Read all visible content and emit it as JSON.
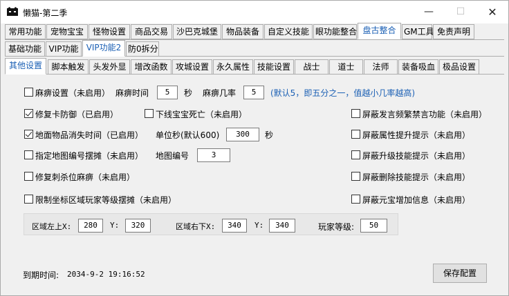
{
  "window": {
    "title": "懒猫-第二季",
    "minimize": "—",
    "maximize": "☐",
    "close": "✕"
  },
  "tabs_row1": [
    "常用功能",
    "宠物宝宝",
    "怪物设置",
    "商品交易",
    "沙巴克城堡",
    "物品装备",
    "自定义技能",
    "眼功能整合",
    "盘古整合",
    "GM工具",
    "免责声明"
  ],
  "tabs_row1_active": "盘古整合",
  "tabs_row2": [
    "基础功能",
    "VIP功能",
    "VIP功能2",
    "防0拆分"
  ],
  "tabs_row2_active": "VIP功能2",
  "tabs_row3": [
    "其他设置",
    "脚本触发",
    "头发外显",
    "增改函数",
    "攻城设置",
    "永久属性",
    "技能设置",
    "战士",
    "道士",
    "法师",
    "装备吸血",
    "极品设置"
  ],
  "tabs_row3_active": "其他设置",
  "settings": {
    "paralysis": {
      "label": "麻痹设置（未启用）",
      "checked": false
    },
    "paralysis_time_label": "麻痹时间",
    "paralysis_time_value": "5",
    "seconds_unit": "秒",
    "paralysis_rate_label": "麻痹几率",
    "paralysis_rate_value": "5",
    "paralysis_hint": "(默认5，即五分之一，值越小几率越高)",
    "fix_card_defense": {
      "label": "修复卡防御（已启用）",
      "checked": true
    },
    "offline_pet_death": {
      "label": "下线宝宝死亡（未启用）",
      "checked": false
    },
    "ground_item_disappear": {
      "label": "地面物品消失时间（已启用）",
      "checked": true
    },
    "unit_seconds_label": "单位秒(默认600)",
    "unit_seconds_value": "300",
    "seconds_unit2": "秒",
    "map_stall": {
      "label": "指定地图编号摆摊（未启用）",
      "checked": false
    },
    "map_number_label": "地图编号",
    "map_number_value": "3",
    "fix_assassin_paralysis": {
      "label": "修复刺杀位麻痹（未启用）",
      "checked": false
    },
    "limit_coord_stall": {
      "label": "限制坐标区域玩家等级摆摊（未启用）",
      "checked": false
    },
    "region_top_left_label": "区域左上X:",
    "region_top_left_x": "280",
    "y_label": "Y:",
    "region_top_left_y": "320",
    "region_bottom_right_label": "区域右下X:",
    "region_bottom_right_x": "340",
    "y_label2": "Y:",
    "region_bottom_right_y": "340",
    "player_level_label": "玩家等级:",
    "player_level_value": "50",
    "block_frequent_speech": {
      "label": "屏蔽发言频繁禁言功能（未启用）",
      "checked": false
    },
    "block_attr_upgrade": {
      "label": "屏蔽属性提升提示（未启用）",
      "checked": false
    },
    "block_skill_upgrade": {
      "label": "屏蔽升级技能提示（未启用）",
      "checked": false
    },
    "block_skill_delete": {
      "label": "屏蔽删除技能提示（未启用）",
      "checked": false
    },
    "block_yuanbao_add": {
      "label": "屏蔽元宝增加信息（未启用）",
      "checked": false
    }
  },
  "expiry_label": "到期时间:",
  "expiry_value": "2034-9-2 19:16:52",
  "save_button": "保存配置",
  "colors": {
    "accent": "#1a5fb4",
    "background": "#f0f0f0"
  }
}
